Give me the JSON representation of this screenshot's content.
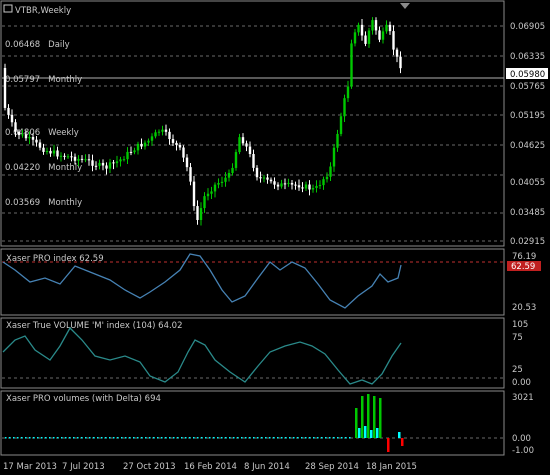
{
  "main": {
    "title": "VTBR,Weekly",
    "levels": [
      {
        "value": "0.06468",
        "label": "Daily"
      },
      {
        "value": "0.05797",
        "label": "Monthly"
      },
      {
        "value": "0.04806",
        "label": "Weekly"
      },
      {
        "value": "0.04220",
        "label": "Monthly"
      },
      {
        "value": "0.03569",
        "label": "Monthly"
      }
    ],
    "axis_ticks": [
      "0.06905",
      "0.06335",
      "0.05765",
      "0.05195",
      "0.04625",
      "0.04055",
      "0.03485",
      "0.02915"
    ],
    "current_price": "0.05980"
  },
  "index_panel": {
    "title": "Xaser PRO index 62.59",
    "ticks": [
      "76.19",
      "20.53"
    ],
    "current": "62.59"
  },
  "volume_panel": {
    "title": "Xaser True VOLUME 'M' index (104) 64.02",
    "ticks": [
      "105",
      "75",
      "25",
      "0.00"
    ]
  },
  "delta_panel": {
    "title": "Xaser PRO volumes (with Delta)  694",
    "ticks": [
      "3021",
      "0.00",
      "-1.00"
    ]
  },
  "time_axis": [
    "17 Mar 2013",
    "7 Jul 2013",
    "27 Oct 2013",
    "16 Feb 2014",
    "8 Jun 2014",
    "28 Sep 2014",
    "18 Jan 2015"
  ],
  "colors": {
    "background": "#000000",
    "up_candle": "#00c800",
    "down_candle": "#ffffff",
    "index_line": "#4682b4",
    "volume_line": "#2a8a8a",
    "delta_green": "#00c800",
    "delta_cyan": "#00ffff",
    "delta_red": "#ff0000",
    "level_marker": "#ff3030"
  }
}
